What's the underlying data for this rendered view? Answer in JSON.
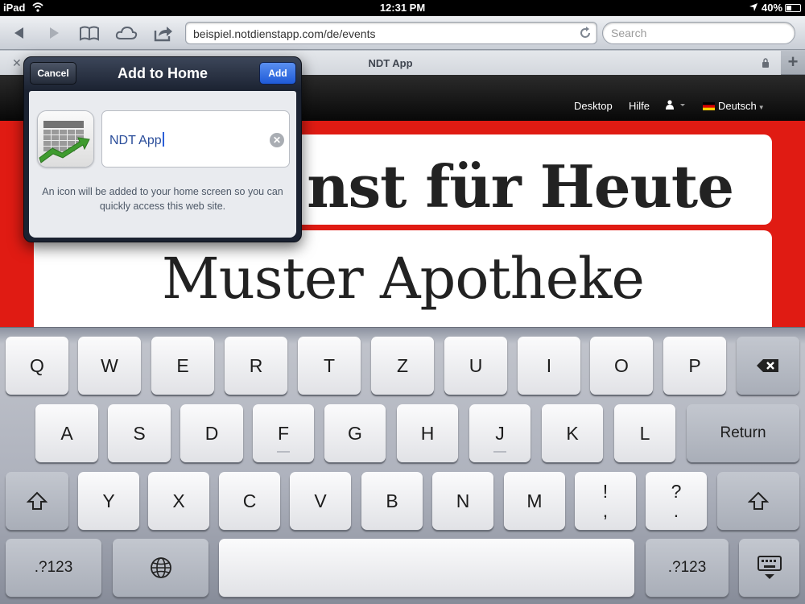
{
  "status_bar": {
    "device": "iPad",
    "time": "12:31 PM",
    "battery": "40%",
    "battery_level": 0.4
  },
  "toolbar": {
    "url": "beispiel.notdienstapp.com/de/events",
    "search_placeholder": "Search"
  },
  "tab": {
    "close": "✕",
    "title": "NDT App",
    "new_tab": "+"
  },
  "web": {
    "nav": [
      "Desktop",
      "Hilfe"
    ],
    "language": "Deutsch",
    "heading": "nst für Heute",
    "pharmacy": "Muster Apotheke"
  },
  "popover": {
    "title": "Add to Home",
    "cancel": "Cancel",
    "add": "Add",
    "name_value": "NDT App",
    "info": "An icon will be added to your home screen so you can quickly access this web site."
  },
  "keyboard": {
    "row1": [
      "Q",
      "W",
      "E",
      "R",
      "T",
      "Z",
      "U",
      "I",
      "O",
      "P"
    ],
    "row2": [
      "A",
      "S",
      "D",
      "F",
      "G",
      "H",
      "J",
      "K",
      "L"
    ],
    "return": "Return",
    "row3": [
      "Y",
      "X",
      "C",
      "V",
      "B",
      "N",
      "M"
    ],
    "punct1": {
      "top": "!",
      "bottom": ","
    },
    "punct2": {
      "top": "?",
      "bottom": "."
    },
    "numbers": ".?123"
  }
}
